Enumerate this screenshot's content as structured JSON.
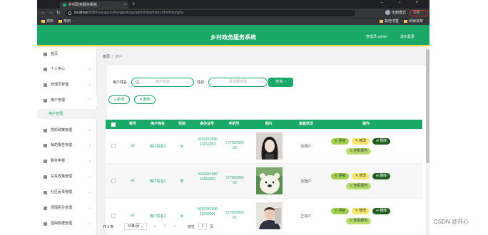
{
  "browser": {
    "tab_title": "乡村政务服务系统",
    "url_host": "localhost",
    "url_path": ":8080/xiangcunzhengwufuwu/admin/dist/index.html#/yonghu",
    "profile_label": "无痕模式",
    "update_label": "更新 ⋮",
    "bookmarks": [
      "资料",
      "常用"
    ],
    "bookmarks_right": [
      "其他书签",
      "阅读清单"
    ]
  },
  "app": {
    "title": "乡村政务服务系统",
    "admin_label": "管理员 admin",
    "logout_label": "退出登录"
  },
  "sidebar": {
    "items": [
      {
        "label": "首页",
        "icon": "home-icon"
      },
      {
        "label": "个人中心",
        "icon": "user-icon"
      },
      {
        "label": "管理员管理",
        "icon": "flag-icon"
      },
      {
        "label": "用户管理",
        "icon": "list-icon"
      },
      {
        "label": "党的政策管理",
        "icon": "menu-icon"
      },
      {
        "label": "我的报告管理",
        "icon": "copy-icon"
      },
      {
        "label": "服务申报",
        "icon": "monitor-icon"
      },
      {
        "label": "扶贫政策管理",
        "icon": "gear-icon"
      },
      {
        "label": "社区民事管理",
        "icon": "chat-icon"
      },
      {
        "label": "周围民生管理",
        "icon": "person-icon"
      },
      {
        "label": "基础数据管理",
        "icon": "chart-icon"
      }
    ],
    "sub_item": "用户管理"
  },
  "breadcrumb": {
    "home": "首页",
    "current": "用户"
  },
  "search": {
    "name_label": "用户姓名",
    "name_placeholder": "用户姓名",
    "gender_label": "性别",
    "gender_placeholder": "请选择性别",
    "query_label": "查询"
  },
  "actions": {
    "add_label": "新增",
    "delete_label": "删除"
  },
  "table": {
    "columns": [
      "索号",
      "用户姓名",
      "性别",
      "身份证号",
      "手机号",
      "照片",
      "家庭状况",
      "操作"
    ],
    "rows": [
      {
        "id": "a3",
        "name": "用户姓名3",
        "gender": "女",
        "idcard": "410224199610252003",
        "phone": "17703786903",
        "status": "贫困户"
      },
      {
        "id": "a2",
        "name": "用户姓名2",
        "gender": "男",
        "idcard": "410224199610252002",
        "phone": "17703786902",
        "status": "贫困户"
      },
      {
        "id": "a1",
        "name": "用户姓名1",
        "gender": "女",
        "idcard": "410224199610252001",
        "phone": "17703786901",
        "status": "正常户"
      }
    ],
    "action_labels": {
      "ping": "评级",
      "edit": "修改",
      "del": "删除",
      "report": "查看报告"
    }
  },
  "pager": {
    "total": "共 3 条",
    "page_size": "10条/页",
    "prev": "‹",
    "page": "1",
    "next": "›",
    "goto_label": "前往",
    "goto_value": "1",
    "page_suffix": "页"
  },
  "watermark": "CSDN @开心",
  "colors": {
    "brand": "#1aa868",
    "accent_bar": "#f4d22b"
  }
}
